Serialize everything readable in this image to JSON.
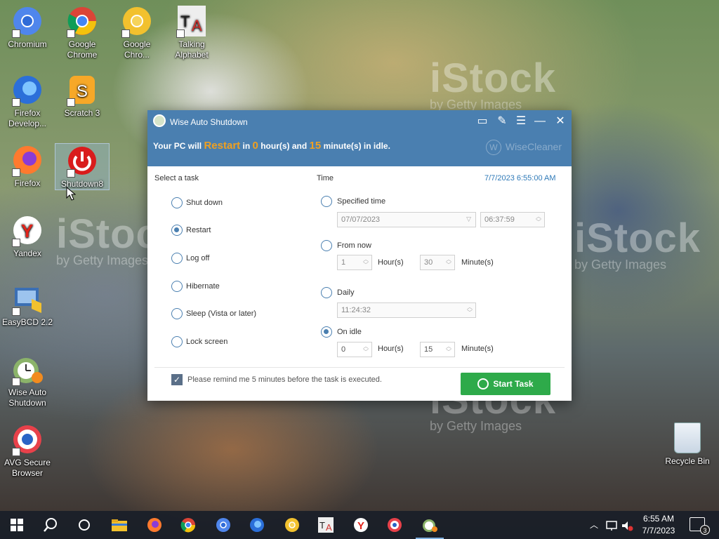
{
  "watermark": {
    "brand": "iStock",
    "sub": "by Getty Images"
  },
  "desktop_icons": [
    {
      "label": "Chromium",
      "icon": "chromium-icon",
      "color": "#4f86ec"
    },
    {
      "label": "Google Chrome",
      "icon": "chrome-icon",
      "color": "#2ca24f"
    },
    {
      "label": "Google Chro...",
      "icon": "chrome-canary-icon",
      "color": "#f2c12e"
    },
    {
      "label": "Talking Alphabet",
      "icon": "talking-alphabet-icon",
      "color": "#d0312d"
    },
    {
      "label": "Firefox Develop...",
      "icon": "firefox-developer-icon",
      "color": "#2b6fd9"
    },
    {
      "label": "Scratch 3",
      "icon": "scratch-icon",
      "color": "#f7a828"
    },
    {
      "label": "Firefox",
      "icon": "firefox-icon",
      "color": "#ff7a2e"
    },
    {
      "label": "Shutdown8",
      "icon": "power-icon",
      "color": "#d91c1c"
    },
    {
      "label": "Yandex",
      "icon": "yandex-icon",
      "color": "#ffffff"
    },
    {
      "label": "EasyBCD 2.2",
      "icon": "easybcd-icon",
      "color": "#3b6fb4"
    },
    {
      "label": "Wise Auto Shutdown",
      "icon": "wise-auto-shutdown-icon",
      "color": "#8bb36a"
    },
    {
      "label": "AVG Secure Browser",
      "icon": "avg-browser-icon",
      "color": "#e8414a"
    }
  ],
  "recycle_bin": {
    "label": "Recycle Bin"
  },
  "window": {
    "title": "Wise Auto Shutdown",
    "status": {
      "prefix": "Your PC will",
      "action": "Restart",
      "in": "in",
      "hours": "0",
      "mid": "hour(s) and",
      "minutes": "15",
      "suffix": "minute(s) in idle."
    },
    "brand": "WiseCleaner",
    "task_header": "Select a task",
    "time_header": "Time",
    "current_datetime": "7/7/2023 6:55:00 AM",
    "tasks": [
      {
        "label": "Shut down",
        "selected": false
      },
      {
        "label": "Restart",
        "selected": true
      },
      {
        "label": "Log off",
        "selected": false
      },
      {
        "label": "Hibernate",
        "selected": false
      },
      {
        "label": "Sleep (Vista or later)",
        "selected": false
      },
      {
        "label": "Lock screen",
        "selected": false
      }
    ],
    "time_options": {
      "specified": {
        "label": "Specified time",
        "date": "07/07/2023",
        "time": "06:37:59",
        "selected": false
      },
      "from_now": {
        "label": "From now",
        "hours": "1",
        "hours_unit": "Hour(s)",
        "minutes": "30",
        "minutes_unit": "Minute(s)",
        "selected": false
      },
      "daily": {
        "label": "Daily",
        "time": "11:24:32",
        "selected": false
      },
      "on_idle": {
        "label": "On idle",
        "hours": "0",
        "hours_unit": "Hour(s)",
        "minutes": "15",
        "minutes_unit": "Minute(s)",
        "selected": true
      }
    },
    "remind_label": "Please remind me 5 minutes before the task is executed.",
    "remind_checked": true,
    "start_button": "Start Task"
  },
  "taskbar": {
    "pinned": [
      "windows-start-icon",
      "search-icon",
      "task-view-icon",
      "file-explorer-icon",
      "firefox-icon",
      "chrome-icon",
      "chromium-icon",
      "firefox-developer-icon",
      "chrome-canary-icon",
      "talking-alphabet-icon",
      "yandex-icon",
      "avg-browser-icon",
      "wise-auto-shutdown-icon"
    ],
    "time": "6:55 AM",
    "date": "7/7/2023",
    "notification_count": "3"
  }
}
